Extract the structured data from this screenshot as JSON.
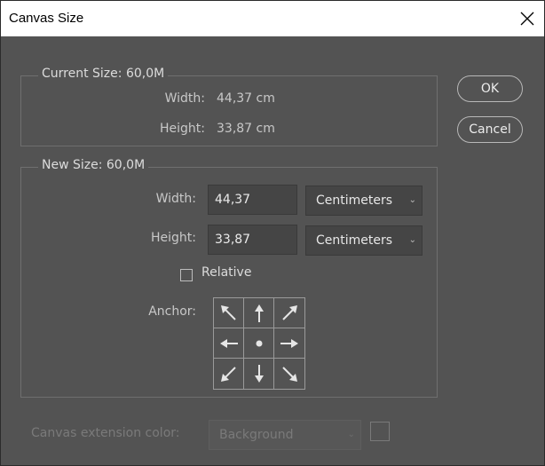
{
  "window": {
    "title": "Canvas Size"
  },
  "buttons": {
    "ok": "OK",
    "cancel": "Cancel"
  },
  "current_size": {
    "legend": "Current Size: 60,0M",
    "width_label": "Width:",
    "width_value": "44,37 cm",
    "height_label": "Height:",
    "height_value": "33,87 cm"
  },
  "new_size": {
    "legend": "New Size: 60,0M",
    "width_label": "Width:",
    "width_value": "44,37",
    "width_unit": "Centimeters",
    "height_label": "Height:",
    "height_value": "33,87",
    "height_unit": "Centimeters",
    "relative_label": "Relative",
    "relative_checked": false,
    "anchor_label": "Anchor:"
  },
  "extension": {
    "label": "Canvas extension color:",
    "value": "Background"
  },
  "icons": {
    "close": "close-icon",
    "dropdown": "chevron-down-icon",
    "anchor": [
      "arrow-up-left-icon",
      "arrow-up-icon",
      "arrow-up-right-icon",
      "arrow-left-icon",
      "center-dot-icon",
      "arrow-right-icon",
      "arrow-down-left-icon",
      "arrow-down-icon",
      "arrow-down-right-icon"
    ]
  },
  "colors": {
    "dialog_bg": "#535353",
    "input_bg": "#454545",
    "text": "#c8c8c8"
  }
}
